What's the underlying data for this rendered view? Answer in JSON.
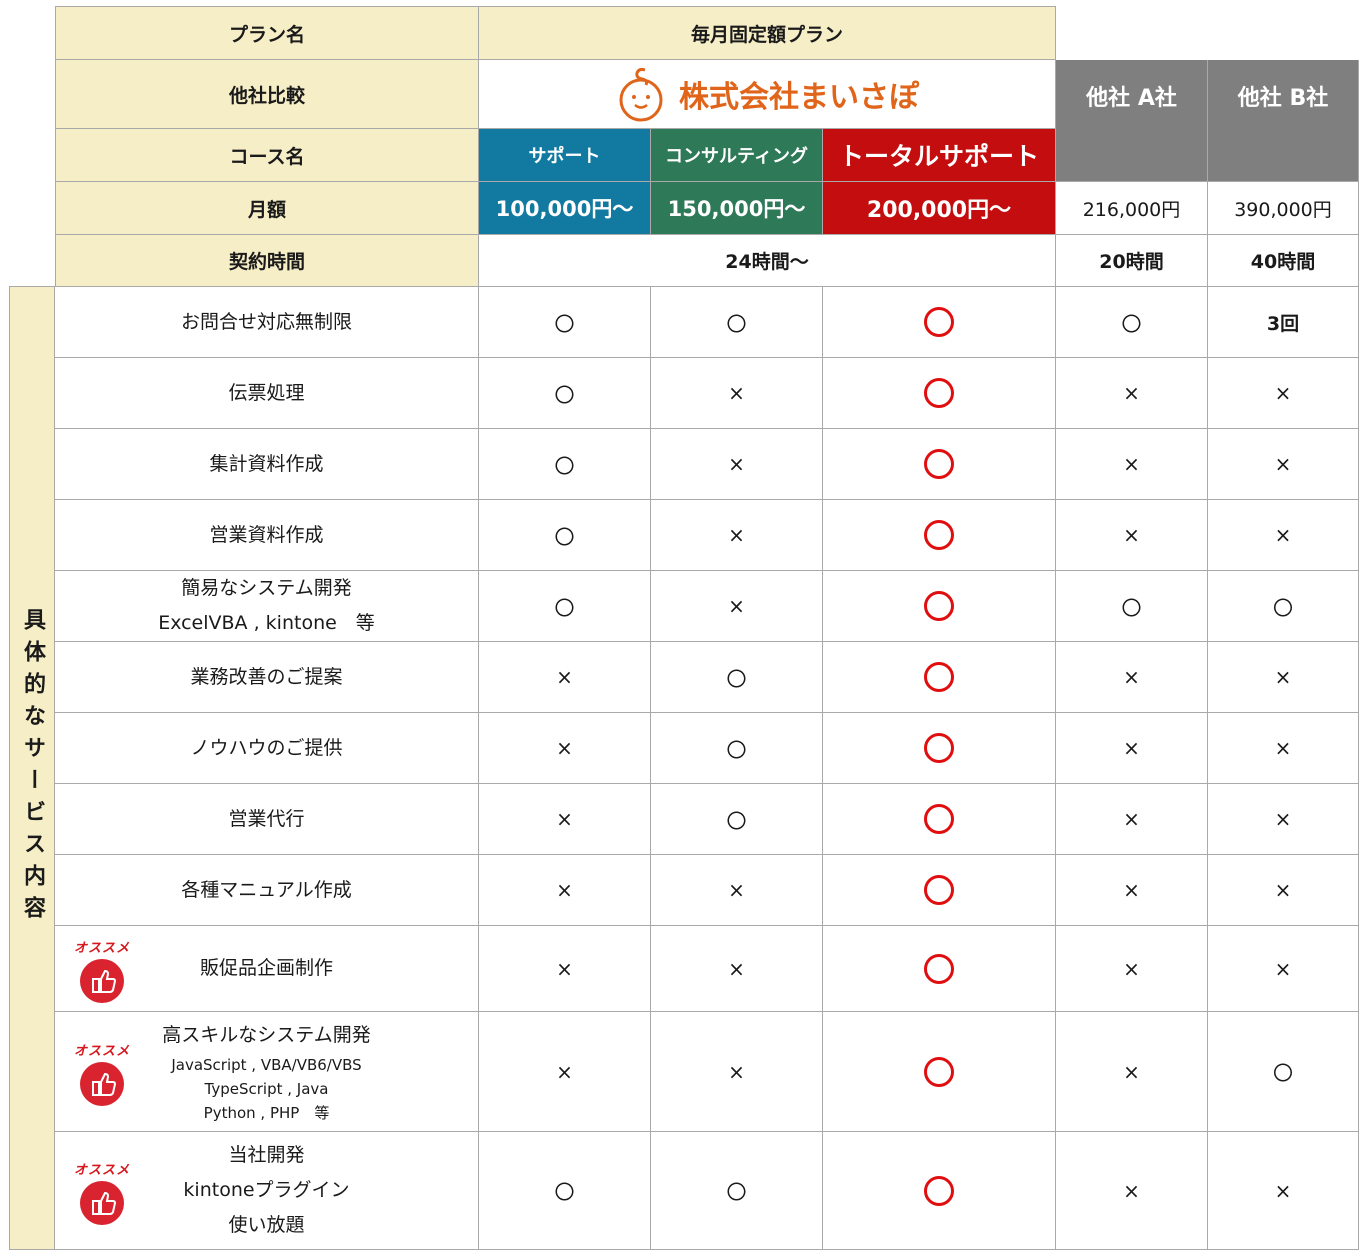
{
  "header": {
    "plan_label": "プラン名",
    "plan_value": "毎月固定額プラン",
    "compare_label": "他社比較",
    "company_logo": "株式会社まいさぽ",
    "other_a": "他社 A社",
    "other_b": "他社 B社",
    "course_label": "コース名",
    "courses": [
      "サポート",
      "コンサルティング",
      "トータルサポート"
    ],
    "price_label": "月額",
    "prices": [
      "100,000円～",
      "150,000円～",
      "200,000円～"
    ],
    "price_a": "216,000円",
    "price_b": "390,000円",
    "hours_label": "契約時間",
    "hours_value": "24時間～",
    "hours_a": "20時間",
    "hours_b": "40時間"
  },
  "side_label": "具体的なサービス内容",
  "recommend_label": "オススメ",
  "colors": {
    "blue": "#127aa0",
    "green": "#2e7958",
    "red": "#c30d0e",
    "header_bg": "#f6eec7",
    "gray": "#7f7f7f"
  },
  "rows": [
    {
      "label": [
        "お問合せ対応無制限"
      ],
      "c1": "〇",
      "c2": "〇",
      "a": "〇",
      "b": "3回"
    },
    {
      "label": [
        "伝票処理"
      ],
      "c1": "〇",
      "c2": "×",
      "a": "×",
      "b": "×"
    },
    {
      "label": [
        "集計資料作成"
      ],
      "c1": "〇",
      "c2": "×",
      "a": "×",
      "b": "×"
    },
    {
      "label": [
        "営業資料作成"
      ],
      "c1": "〇",
      "c2": "×",
      "a": "×",
      "b": "×"
    },
    {
      "label": [
        "簡易なシステム開発",
        "ExcelVBA , kintone　等"
      ],
      "c1": "〇",
      "c2": "×",
      "a": "〇",
      "b": "〇"
    },
    {
      "label": [
        "業務改善のご提案"
      ],
      "c1": "×",
      "c2": "〇",
      "a": "×",
      "b": "×"
    },
    {
      "label": [
        "ノウハウのご提供"
      ],
      "c1": "×",
      "c2": "〇",
      "a": "×",
      "b": "×"
    },
    {
      "label": [
        "営業代行"
      ],
      "c1": "×",
      "c2": "〇",
      "a": "×",
      "b": "×"
    },
    {
      "label": [
        "各種マニュアル作成"
      ],
      "c1": "×",
      "c2": "×",
      "a": "×",
      "b": "×"
    },
    {
      "label": [
        "販促品企画制作"
      ],
      "c1": "×",
      "c2": "×",
      "a": "×",
      "b": "×"
    },
    {
      "label": [
        "高スキルなシステム開発",
        "JavaScript , VBA/VB6/VBS",
        "TypeScript , Java",
        "Python , PHP　等"
      ],
      "c1": "×",
      "c2": "×",
      "a": "×",
      "b": "〇"
    },
    {
      "label": [
        "当社開発",
        "kintoneプラグイン",
        "使い放題"
      ],
      "c1": "〇",
      "c2": "〇",
      "a": "×",
      "b": "×"
    }
  ]
}
